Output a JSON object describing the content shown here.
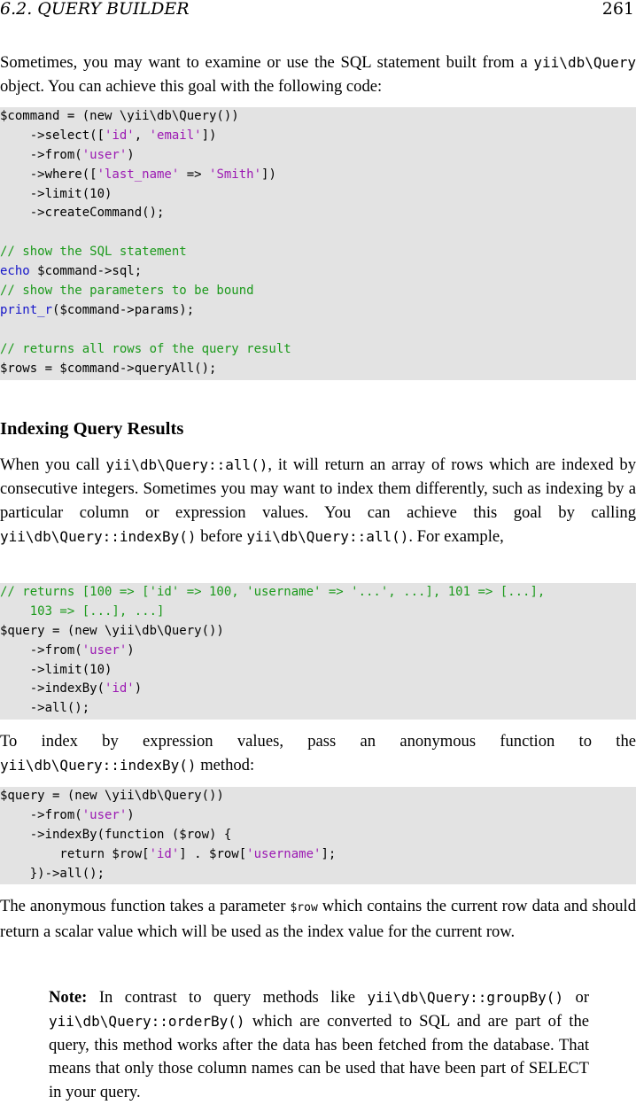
{
  "header": {
    "section": "6.2.   QUERY BUILDER",
    "page_number": "261"
  },
  "p1": {
    "t1": "Sometimes, you may want to examine or use the SQL statement built from a ",
    "c1": "yii\\db\\Query",
    "t2": " object. You can achieve this goal with the following code:"
  },
  "code1": [
    [
      {
        "t": "$command = (new \\yii\\db\\Query())"
      }
    ],
    [
      {
        "t": "    ->select(["
      },
      {
        "t": "'id'",
        "k": "str"
      },
      {
        "t": ", "
      },
      {
        "t": "'email'",
        "k": "str"
      },
      {
        "t": "])"
      }
    ],
    [
      {
        "t": "    ->from("
      },
      {
        "t": "'user'",
        "k": "str"
      },
      {
        "t": ")"
      }
    ],
    [
      {
        "t": "    ->where(["
      },
      {
        "t": "'last_name'",
        "k": "str"
      },
      {
        "t": " => "
      },
      {
        "t": "'Smith'",
        "k": "str"
      },
      {
        "t": "])"
      }
    ],
    [
      {
        "t": "    ->limit(10)"
      }
    ],
    [
      {
        "t": "    ->createCommand();"
      }
    ],
    [
      {
        "t": ""
      }
    ],
    [
      {
        "t": "// show the SQL statement",
        "k": "com"
      }
    ],
    [
      {
        "t": "echo",
        "k": "kw"
      },
      {
        "t": " $command->sql;"
      }
    ],
    [
      {
        "t": "// show the parameters to be bound",
        "k": "com"
      }
    ],
    [
      {
        "t": "print_r",
        "k": "kw"
      },
      {
        "t": "($command->params);"
      }
    ],
    [
      {
        "t": ""
      }
    ],
    [
      {
        "t": "// returns all rows of the query result",
        "k": "com"
      }
    ],
    [
      {
        "t": "$rows = $command->queryAll();"
      }
    ]
  ],
  "heading": "Indexing Query Results",
  "p2": {
    "t1": "When you call ",
    "c1": "yii\\db\\Query::all()",
    "t2": ", it will return an array of rows which are indexed by consecutive integers. Sometimes you may want to index them differently, such as indexing by a particular column or expression values. You can achieve this goal by calling ",
    "c2": "yii\\db\\Query::indexBy()",
    "t3": " before ",
    "c3": "yii\\db\\Query::all()",
    "t4": ". For example,"
  },
  "code2": [
    [
      {
        "t": "// returns [100 => ['id' => 100, 'username' => '...', ...], 101 => [...],",
        "k": "com"
      }
    ],
    [
      {
        "t": "    103 => [...], ...]",
        "k": "com"
      }
    ],
    [
      {
        "t": "$query = (new \\yii\\db\\Query())"
      }
    ],
    [
      {
        "t": "    ->from("
      },
      {
        "t": "'user'",
        "k": "str"
      },
      {
        "t": ")"
      }
    ],
    [
      {
        "t": "    ->limit(10)"
      }
    ],
    [
      {
        "t": "    ->indexBy("
      },
      {
        "t": "'id'",
        "k": "str"
      },
      {
        "t": ")"
      }
    ],
    [
      {
        "t": "    ->all();"
      }
    ]
  ],
  "p3": {
    "t1": "To index by expression values, pass an anonymous function to the ",
    "c1": "yii\\db\\Query::indexBy()",
    "t2": " method:"
  },
  "code3": [
    [
      {
        "t": "$query = (new \\yii\\db\\Query())"
      }
    ],
    [
      {
        "t": "    ->from("
      },
      {
        "t": "'user'",
        "k": "str"
      },
      {
        "t": ")"
      }
    ],
    [
      {
        "t": "    ->indexBy(function ($row) {"
      }
    ],
    [
      {
        "t": "        return $row["
      },
      {
        "t": "'id'",
        "k": "str"
      },
      {
        "t": "] . $row["
      },
      {
        "t": "'username'",
        "k": "str"
      },
      {
        "t": "];"
      }
    ],
    [
      {
        "t": "    })->all();"
      }
    ]
  ],
  "p4": {
    "t1": "The anonymous function takes a parameter ",
    "c1": "$row",
    "t2": " which contains the current row data and should return a scalar value which will be used as the index value for the current row."
  },
  "note": {
    "label": "Note:",
    "t1": " In contrast to query methods like ",
    "c1": "yii\\db\\Query::groupBy()",
    "t2": " or ",
    "c2": "yii\\db\\Query::orderBy()",
    "t3": " which are converted to SQL and are part of the query, this method works after the data has been fetched from the database. That means that only those column names can be used that have been part of SELECT in your query."
  }
}
